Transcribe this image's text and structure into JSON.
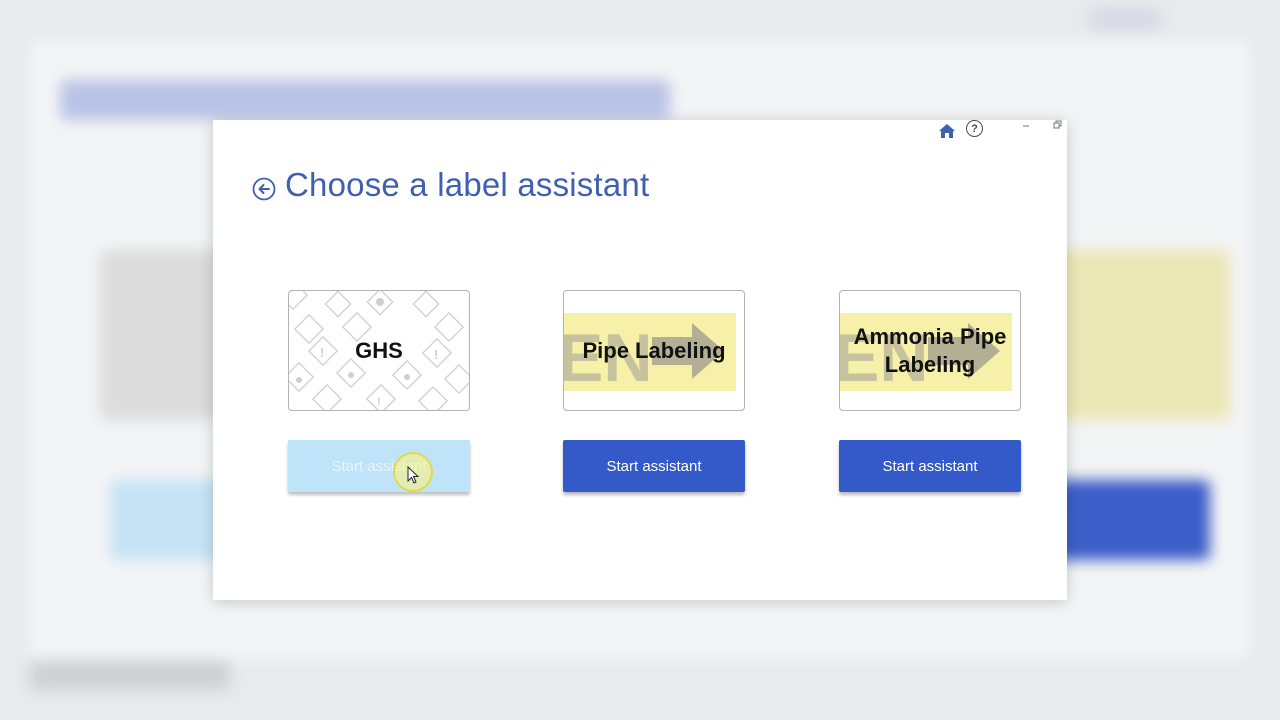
{
  "dialog": {
    "title": "Choose a label assistant",
    "icons": {
      "home": "home-icon",
      "help": "help-icon",
      "help_glyph": "?",
      "minimize": "minimize-icon",
      "restore": "restore-icon",
      "back": "back-arrow-icon"
    }
  },
  "assistants": [
    {
      "label": "GHS",
      "button_label": "Start assistant",
      "state": "hover"
    },
    {
      "label": "Pipe Labeling",
      "button_label": "Start assistant",
      "state": "normal"
    },
    {
      "label": "Ammonia Pipe Labeling",
      "button_label": "Start assistant",
      "state": "normal"
    }
  ],
  "colors": {
    "accent": "#3459c8",
    "title": "#3f5fb0",
    "hover_button": "#bfe3f8",
    "pipe_banner": "#f7f0a8"
  }
}
